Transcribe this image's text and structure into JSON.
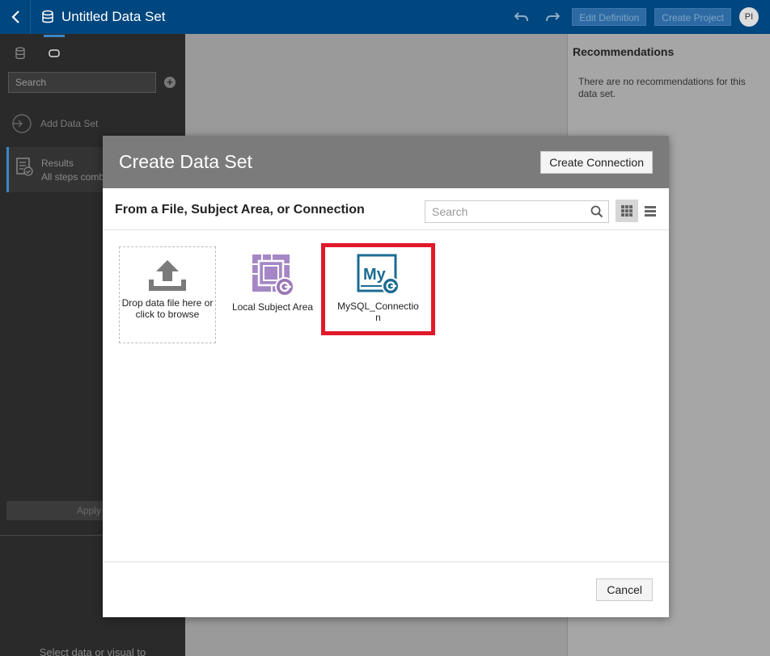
{
  "topbar": {
    "title": "Untitled Data Set",
    "edit_definition": "Edit Definition",
    "create_project": "Create Project",
    "avatar_initials": "PI"
  },
  "left_panel": {
    "search_placeholder": "Search",
    "add_data_set": "Add Data Set",
    "results_title": "Results",
    "results_subtitle": "All steps comb",
    "apply_button": "Apply Sc",
    "bottom_hint": "Select data or visual to"
  },
  "right_panel": {
    "title": "Recommendations",
    "text": "There are no recommendations for this data set."
  },
  "dialog": {
    "title": "Create Data Set",
    "create_connection": "Create Connection",
    "subtitle": "From a File, Subject Area, or Connection",
    "search_placeholder": "Search",
    "tiles": {
      "drop_label": "Drop data file here or click to browse",
      "local_label": "Local Subject Area",
      "mysql_label": "MySQL_Connection",
      "mysql_icon_text": "My"
    },
    "cancel": "Cancel"
  },
  "colors": {
    "topbar": "#00467f",
    "dialog_header": "#7b7b7b",
    "highlight": "#e0192a",
    "mysql_icon": "#1b6c93",
    "local_icon": "#9b77b7"
  }
}
